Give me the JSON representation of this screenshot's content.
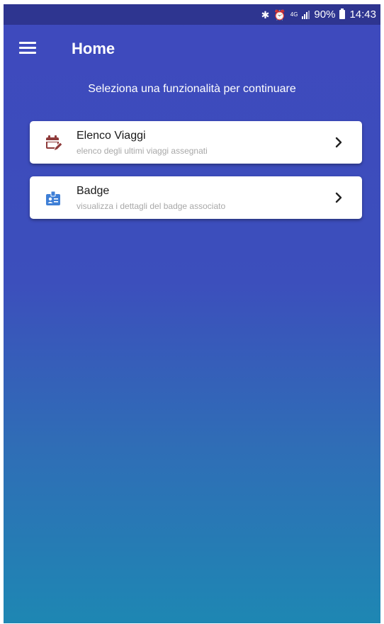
{
  "status_bar": {
    "network": "4G",
    "battery": "90%",
    "time": "14:43"
  },
  "app_bar": {
    "title": "Home"
  },
  "main": {
    "subtitle": "Seleziona una funzionalità per continuare",
    "items": [
      {
        "title": "Elenco Viaggi",
        "description": "elenco degli ultimi viaggi assegnati",
        "icon": "calendar-edit-icon",
        "icon_color": "#8e3b3b"
      },
      {
        "title": "Badge",
        "description": "visualizza i dettagli del badge associato",
        "icon": "badge-icon",
        "icon_color": "#3f7fd6"
      }
    ]
  },
  "colors": {
    "status_bar": "#2e3590",
    "gradient_top": "#3e49bd",
    "gradient_bottom": "#1e87b3",
    "card": "#ffffff"
  }
}
